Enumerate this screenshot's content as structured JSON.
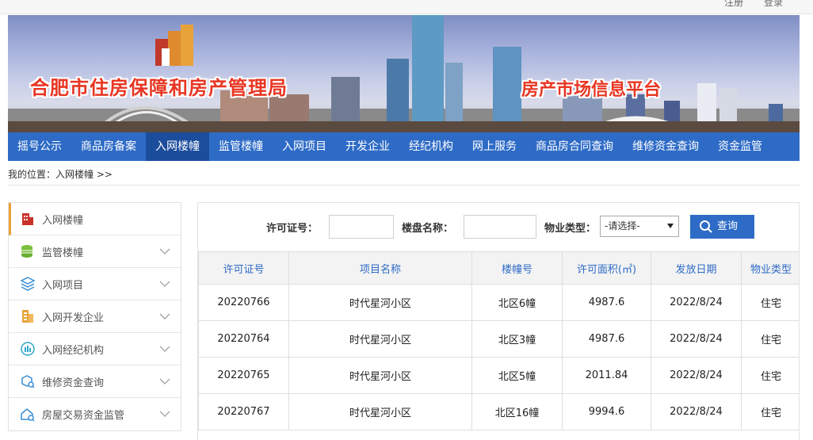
{
  "topbar": {
    "register": "注册",
    "login": "登录"
  },
  "banner": {
    "org_title": "合肥市住房保障和房产管理局",
    "platform_title": "房产市场信息平台"
  },
  "nav": {
    "items": [
      "摇号公示",
      "商品房备案",
      "入网楼幢",
      "监管楼幢",
      "入网项目",
      "开发企业",
      "经纪机构",
      "网上服务",
      "商品房合同查询",
      "维修资金查询",
      "资金监管"
    ],
    "active": "入网楼幢"
  },
  "breadcrumb": {
    "text": "我的位置：入网楼幢 >>"
  },
  "sidebar": {
    "items": [
      {
        "label": "入网楼幢",
        "icon": "building-icon",
        "color": "#c8322b"
      },
      {
        "label": "监管楼幢",
        "icon": "coins-icon",
        "color": "#7cbf3f"
      },
      {
        "label": "入网项目",
        "icon": "layers-icon",
        "color": "#3a8ed4"
      },
      {
        "label": "入网开发企业",
        "icon": "office-icon",
        "color": "#e8a23a"
      },
      {
        "label": "入网经纪机构",
        "icon": "agency-icon",
        "color": "#2fa6c9"
      },
      {
        "label": "维修资金查询",
        "icon": "box-search-icon",
        "color": "#3a8ed4"
      },
      {
        "label": "房屋交易资金监管",
        "icon": "house-search-icon",
        "color": "#3a8ed4"
      }
    ]
  },
  "search": {
    "license_label": "许可证号：",
    "name_label": "楼盘名称：",
    "type_label": "物业类型：",
    "type_selected": "-请选择-",
    "button_label": "查询"
  },
  "table": {
    "headers": [
      "许可证号",
      "项目名称",
      "楼幢号",
      "许可面积(㎡)",
      "发放日期",
      "物业类型"
    ],
    "rows": [
      [
        "20220766",
        "时代星河小区",
        "北区6幢",
        "4987.6",
        "2022/8/24",
        "住宅"
      ],
      [
        "20220764",
        "时代星河小区",
        "北区3幢",
        "4987.6",
        "2022/8/24",
        "住宅"
      ],
      [
        "20220765",
        "时代星河小区",
        "北区5幢",
        "2011.84",
        "2022/8/24",
        "住宅"
      ],
      [
        "20220767",
        "时代星河小区",
        "北区16幢",
        "9994.6",
        "2022/8/24",
        "住宅"
      ]
    ]
  },
  "colors": {
    "nav": "#2e6bc6",
    "nav_active": "#1b4d9c",
    "title_red": "#e83623",
    "header_text": "#2e6bc6"
  }
}
